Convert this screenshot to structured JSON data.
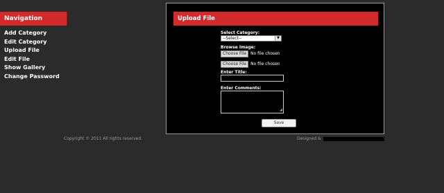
{
  "sidebar": {
    "title": "Navigation",
    "items": [
      {
        "label": "Add Category"
      },
      {
        "label": "Edit Category"
      },
      {
        "label": "Upload File"
      },
      {
        "label": "Edit File"
      },
      {
        "label": "Show Gallery"
      },
      {
        "label": "Change Password"
      }
    ]
  },
  "panel": {
    "title": "Upload File",
    "form": {
      "category_label": "Select Category:",
      "category_value": "--Select--",
      "browse_label": "Browse Image:",
      "file_button": "Choose File",
      "file_status": "No file chosen",
      "title_label": "Enter Title:",
      "comments_label": "Enter Comments:",
      "save_label": "Save"
    }
  },
  "footer": {
    "copyright": "Copyright © 2011 All rights reserved.",
    "designed": "Designed &"
  },
  "colors": {
    "accent_red": "#d32b2b",
    "page_bg": "#2b2b2b",
    "panel_bg": "#000000"
  }
}
